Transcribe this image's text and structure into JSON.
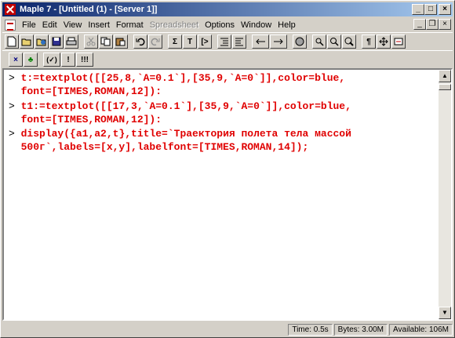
{
  "window": {
    "title": "Maple 7 - [Untitled (1) - [Server 1]]",
    "buttons": {
      "minimize": "_",
      "maximize": "□",
      "close": "×"
    }
  },
  "menu": {
    "items": [
      "File",
      "Edit",
      "View",
      "Insert",
      "Format",
      "Spreadsheet",
      "Options",
      "Window",
      "Help"
    ],
    "disabled": "Spreadsheet",
    "doc_buttons": {
      "minimize": "_",
      "restore": "❐",
      "close": "×"
    }
  },
  "toolbar1": {
    "icons": [
      "new-icon",
      "open-icon",
      "open-url-icon",
      "save-icon",
      "print-icon",
      "cut-icon",
      "copy-icon",
      "paste-icon",
      "undo-icon",
      "redo-icon",
      "sigma-icon",
      "text-icon",
      "prompt-icon",
      "indent-icon",
      "outdent-icon",
      "back-icon",
      "forward-icon",
      "stop-icon",
      "zoom-100-icon",
      "zoom-200-icon",
      "zoom-400-icon",
      "paragraph-icon",
      "expand-icon",
      "restart-icon"
    ],
    "labels": {
      "sigma": "Σ",
      "text": "T",
      "prompt": "[>",
      "paragraph": "¶"
    }
  },
  "toolbar2": {
    "labels": {
      "x": "×",
      "tree": "♣",
      "paren": "(✓)",
      "bang": "!",
      "triple_bang": "!!!"
    }
  },
  "worksheet": {
    "prompt_symbol": ">",
    "lines": [
      {
        "prompt": true,
        "text": "t:=textplot([[25,8,`A=0.1`],[35,9,`A=0`]],color=blue,"
      },
      {
        "prompt": false,
        "text": "font=[TIMES,ROMAN,12]):"
      },
      {
        "prompt": true,
        "text": "t1:=textplot([[17,3,`A=0.1`],[35,9,`A=0`]],color=blue,"
      },
      {
        "prompt": false,
        "text": "font=[TIMES,ROMAN,12]):"
      },
      {
        "prompt": true,
        "text": "display({a1,a2,t},title=`Траектория полета тела массой"
      },
      {
        "prompt": false,
        "text": "500г`,labels=[x,y],labelfont=[TIMES,ROMAN,14]);"
      }
    ]
  },
  "status": {
    "time": "Time:  0.5s",
    "bytes": "Bytes: 3.00M",
    "available": "Available: 106M"
  },
  "colors": {
    "input_text": "#e00000",
    "title_gradient_start": "#0a246a",
    "title_gradient_end": "#a6caf0"
  }
}
